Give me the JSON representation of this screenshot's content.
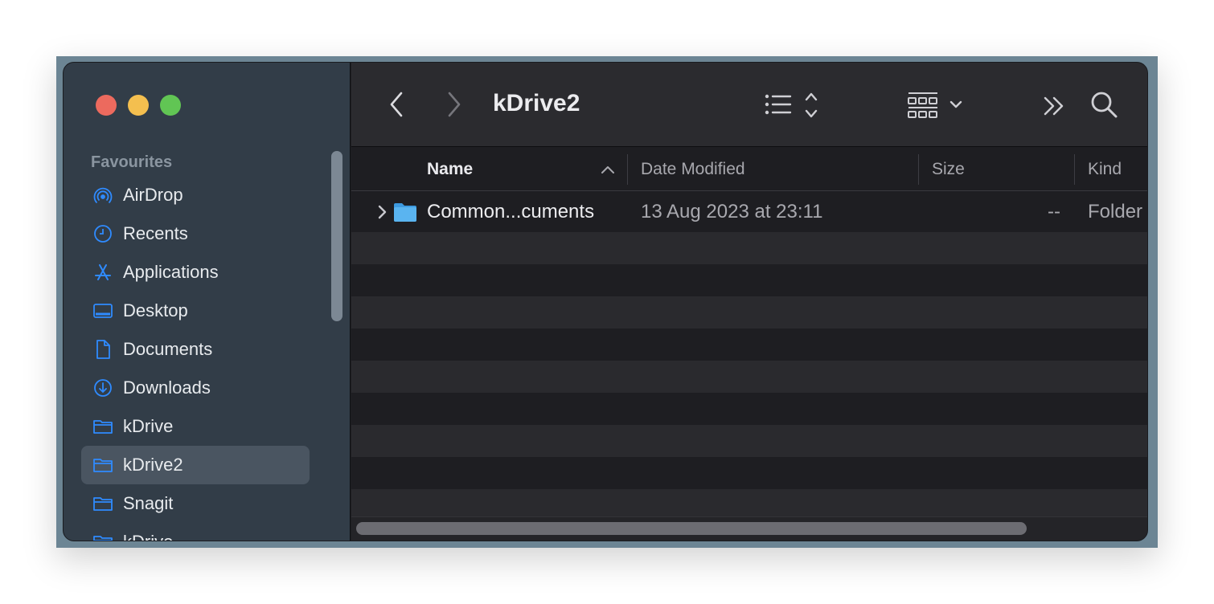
{
  "window": {
    "title": "kDrive2"
  },
  "sidebar": {
    "section_header": "Favourites",
    "items": [
      {
        "label": "AirDrop",
        "icon": "airdrop-icon"
      },
      {
        "label": "Recents",
        "icon": "clock-icon"
      },
      {
        "label": "Applications",
        "icon": "applications-icon"
      },
      {
        "label": "Desktop",
        "icon": "desktop-icon"
      },
      {
        "label": "Documents",
        "icon": "document-icon"
      },
      {
        "label": "Downloads",
        "icon": "download-icon"
      },
      {
        "label": "kDrive",
        "icon": "folder-icon"
      },
      {
        "label": "kDrive2",
        "icon": "folder-icon",
        "selected": true
      },
      {
        "label": "Snagit",
        "icon": "folder-icon"
      },
      {
        "label": "kDrive",
        "icon": "folder-icon"
      }
    ]
  },
  "toolbar": {
    "back_icon": "chevron-left-icon",
    "forward_icon": "chevron-right-icon",
    "view_icon": "list-view-icon",
    "group_icon": "grid-group-icon",
    "more_icon": "double-chevron-icon",
    "search_icon": "search-icon"
  },
  "table": {
    "columns": [
      "Name",
      "Date Modified",
      "Size",
      "Kind"
    ],
    "rows": [
      {
        "name": "Common...cuments",
        "date": "13 Aug 2023 at 23:11",
        "size": "--",
        "kind": "Folder"
      }
    ]
  },
  "colors": {
    "accent": "#0a84ff",
    "folder": "#5ab4f0",
    "sidebar_bg": "#323d48",
    "main_bg": "#1e1e22"
  }
}
